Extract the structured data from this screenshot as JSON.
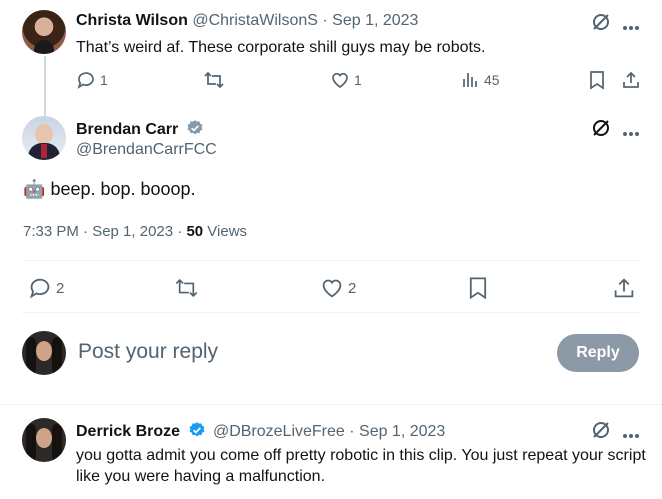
{
  "tweets": {
    "christa": {
      "name": "Christa Wilson",
      "meta": "@ChristaWilsonS · Sep 1, 2023",
      "text": "That’s weird af. These corporate shill guys may be robots.",
      "replies": "1",
      "likes": "1",
      "views": "45"
    },
    "brendan": {
      "name": "Brendan Carr",
      "handle": "@BrendanCarrFCC",
      "text_emoji": "🤖",
      "text": "beep. bop. booop.",
      "timestamp": "7:33 PM · Sep 1, 2023 · ",
      "views_count": "50",
      "views_label": " Views",
      "replies": "2",
      "likes": "2"
    },
    "derrick": {
      "name": "Derrick Broze",
      "meta": "@DBrozeLiveFree · Sep 1, 2023",
      "text": "you gotta admit you come off pretty robotic in this clip. You just repeat your script like you were having a malfunction."
    }
  },
  "reply_box": {
    "placeholder": "Post your reply",
    "button_label": "Reply"
  },
  "colors": {
    "verified": "#829aab",
    "verified_blue": "#1d9bf0",
    "reply_button_bg": "#8b98a5"
  }
}
